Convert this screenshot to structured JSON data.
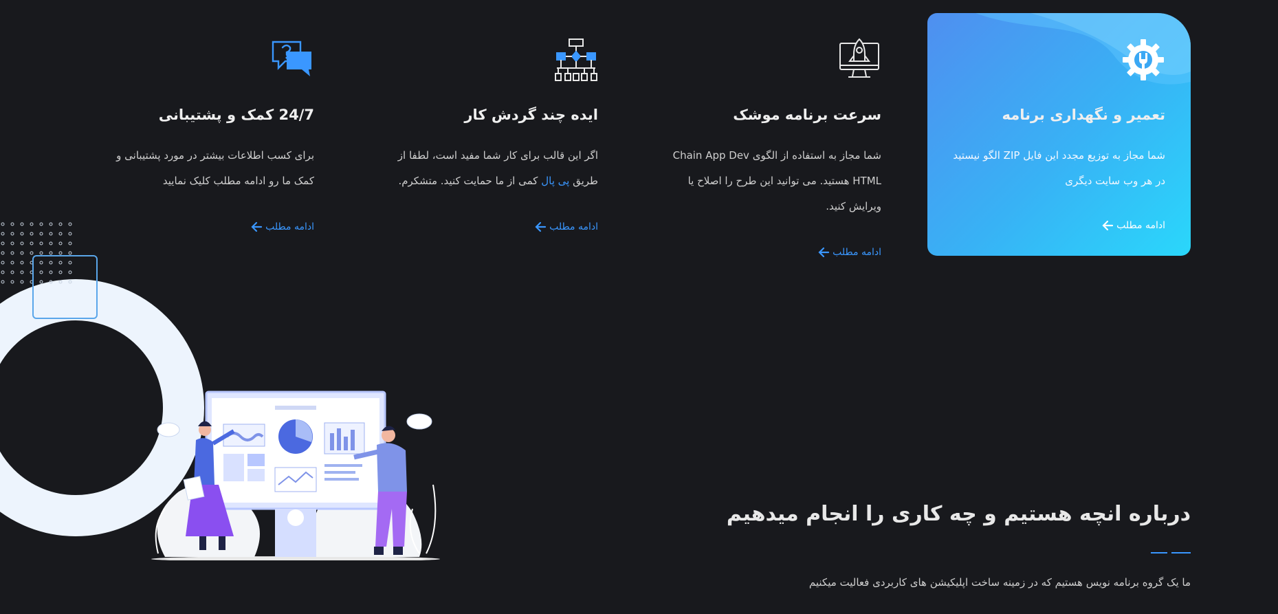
{
  "cards": [
    {
      "title": "تعمیر و نگهداری برنامه",
      "desc": "شما مجاز به توزیع مجدد این فایل ZIP الگو نیستید در هر وب سایت دیگری",
      "more": "ادامه مطلب",
      "icon": "gear-wrench-icon",
      "active": true
    },
    {
      "title": "سرعت برنامه موشک",
      "desc": "شما مجاز به استفاده از الگوی Chain App Dev HTML هستید. می توانید این طرح را اصلاح یا ویرایش کنید.",
      "more": "ادامه مطلب",
      "icon": "rocket-monitor-icon",
      "active": false
    },
    {
      "title": "ایده چند گردش کار",
      "desc_before": "اگر این قالب برای کار شما مفید است، لطفا از طریق",
      "desc_link": "پی پال",
      "desc_after": "کمی از ما حمایت کنید. متشکرم.",
      "more": "ادامه مطلب",
      "icon": "workflow-diagram-icon",
      "active": false
    },
    {
      "title": "24/7 کمک و پشتیبانی",
      "desc": "برای کسب اطلاعات بیشتر در مورد پشتیبانی و کمک ما رو ادامه مطلب کلیک نمایید",
      "more": "ادامه مطلب",
      "icon": "chat-support-icon",
      "active": false
    }
  ],
  "about": {
    "title": "درباره انچه هستیم و چه کاری را انجام میدهیم",
    "subtitle": "ما یک گروه برنامه نویس هستیم که در زمینه ساخت اپلیکیشن های کاربردی فعالیت میکنیم"
  },
  "colors": {
    "background": "#18191d",
    "accent": "#3a97ff",
    "card_gradient_start": "#4f8ff0",
    "card_gradient_end": "#2ad7fb"
  }
}
